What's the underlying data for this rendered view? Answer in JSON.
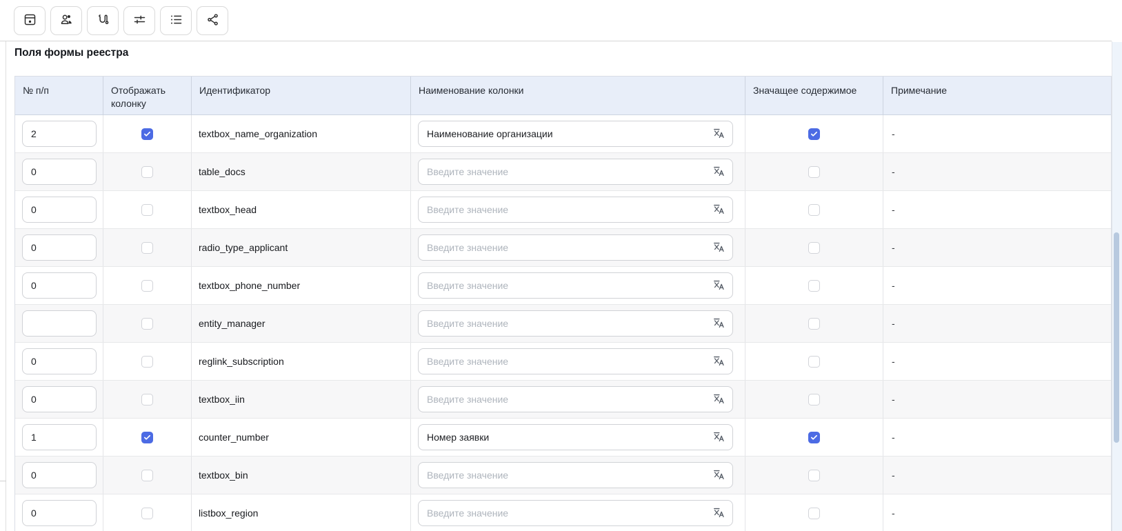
{
  "toolbar": {
    "buttons": [
      {
        "name": "save-button",
        "icon": "save-icon"
      },
      {
        "name": "users-button",
        "icon": "users-icon"
      },
      {
        "name": "route-button",
        "icon": "route-icon"
      },
      {
        "name": "adjustments-button",
        "icon": "adjustments-icon"
      },
      {
        "name": "list-button",
        "icon": "list-icon"
      },
      {
        "name": "share-button",
        "icon": "share-icon"
      }
    ]
  },
  "page": {
    "title": "Поля формы реестра"
  },
  "table": {
    "columns": [
      "№ п/п",
      "Отображать колонку",
      "Идентификатор",
      "Наименование колонки",
      "Значащее содержимое",
      "Примечание"
    ],
    "name_placeholder": "Введите значение",
    "rows": [
      {
        "num": "2",
        "display_column": true,
        "identifier": "textbox_name_organization",
        "column_name": "Наименование организации",
        "significant": true,
        "note": "-"
      },
      {
        "num": "0",
        "display_column": false,
        "identifier": "table_docs",
        "column_name": "",
        "significant": false,
        "note": "-"
      },
      {
        "num": "0",
        "display_column": false,
        "identifier": "textbox_head",
        "column_name": "",
        "significant": false,
        "note": "-"
      },
      {
        "num": "0",
        "display_column": false,
        "identifier": "radio_type_applicant",
        "column_name": "",
        "significant": false,
        "note": "-"
      },
      {
        "num": "0",
        "display_column": false,
        "identifier": "textbox_phone_number",
        "column_name": "",
        "significant": false,
        "note": "-"
      },
      {
        "num": "",
        "display_column": false,
        "identifier": "entity_manager",
        "column_name": "",
        "significant": false,
        "note": "-"
      },
      {
        "num": "0",
        "display_column": false,
        "identifier": "reglink_subscription",
        "column_name": "",
        "significant": false,
        "note": "-"
      },
      {
        "num": "0",
        "display_column": false,
        "identifier": "textbox_iin",
        "column_name": "",
        "significant": false,
        "note": "-"
      },
      {
        "num": "1",
        "display_column": true,
        "identifier": "counter_number",
        "column_name": "Номер заявки",
        "significant": true,
        "note": "-"
      },
      {
        "num": "0",
        "display_column": false,
        "identifier": "textbox_bin",
        "column_name": "",
        "significant": false,
        "note": "-"
      },
      {
        "num": "0",
        "display_column": false,
        "identifier": "listbox_region",
        "column_name": "",
        "significant": false,
        "note": "-"
      }
    ]
  },
  "colors": {
    "accent": "#4c6be4",
    "header_bg": "#e8eef9",
    "stripe": "#f7f7f8",
    "scrollbar_thumb": "#b7c9df"
  }
}
